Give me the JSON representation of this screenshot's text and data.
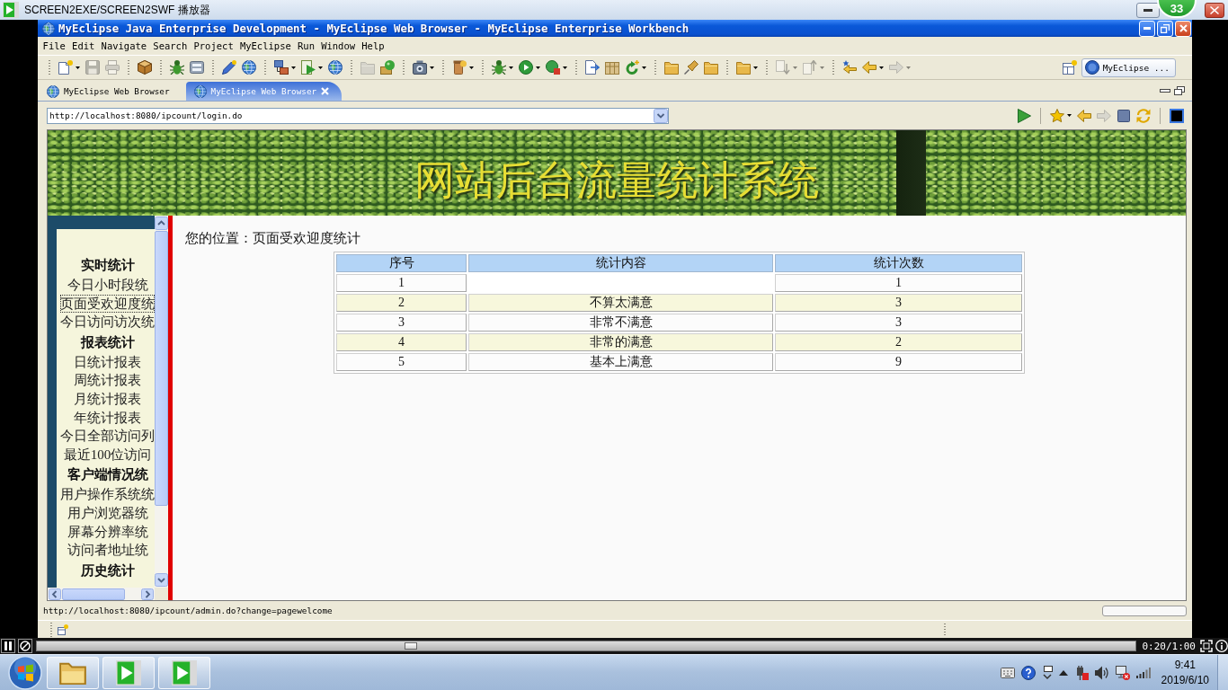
{
  "player_window": {
    "title": "SCREEN2EXE/SCREEN2SWF 播放器",
    "badge": "33"
  },
  "window": {
    "title": "MyEclipse Java Enterprise Development - MyEclipse Web Browser - MyEclipse Enterprise Workbench"
  },
  "menu": [
    "File",
    "Edit",
    "Navigate",
    "Search",
    "Project",
    "MyEclipse",
    "Run",
    "Window",
    "Help"
  ],
  "toolbar": [
    [
      {
        "kind": "new",
        "disabled": false,
        "dropdown": true
      },
      {
        "kind": "save",
        "disabled": true,
        "dropdown": false
      },
      {
        "kind": "print",
        "disabled": true,
        "dropdown": false
      }
    ],
    [
      {
        "kind": "cube",
        "disabled": false,
        "dropdown": false
      }
    ],
    [
      {
        "kind": "bug",
        "disabled": false,
        "dropdown": false
      },
      {
        "kind": "server",
        "disabled": false,
        "dropdown": false
      }
    ],
    [
      {
        "kind": "pencil",
        "disabled": false,
        "dropdown": false
      },
      {
        "kind": "globe",
        "disabled": false,
        "dropdown": false
      }
    ],
    [
      {
        "kind": "boxes",
        "disabled": false,
        "dropdown": true
      },
      {
        "kind": "pageplay",
        "disabled": false,
        "dropdown": true
      },
      {
        "kind": "globe",
        "disabled": false,
        "dropdown": false
      }
    ],
    [
      {
        "kind": "folder",
        "disabled": true,
        "dropdown": false
      },
      {
        "kind": "ball",
        "disabled": false,
        "dropdown": false
      }
    ],
    [
      {
        "kind": "camera",
        "disabled": false,
        "dropdown": true
      }
    ],
    [
      {
        "kind": "jar",
        "disabled": false,
        "dropdown": true
      }
    ],
    [
      {
        "kind": "bug",
        "disabled": false,
        "dropdown": true
      },
      {
        "kind": "play",
        "disabled": false,
        "dropdown": true
      },
      {
        "kind": "tool",
        "disabled": false,
        "dropdown": true
      }
    ],
    [
      {
        "kind": "openfile",
        "disabled": false,
        "dropdown": false
      },
      {
        "kind": "crate",
        "disabled": false,
        "dropdown": false
      },
      {
        "kind": "refresh",
        "disabled": false,
        "dropdown": true
      }
    ],
    [
      {
        "kind": "folder",
        "disabled": false,
        "dropdown": false
      },
      {
        "kind": "pin",
        "disabled": false,
        "dropdown": false
      },
      {
        "kind": "folder",
        "disabled": false,
        "dropdown": false
      }
    ],
    [
      {
        "kind": "folder",
        "disabled": false,
        "dropdown": true
      }
    ],
    [
      {
        "kind": "pagedown",
        "disabled": true,
        "dropdown": true
      },
      {
        "kind": "pageup",
        "disabled": true,
        "dropdown": true
      }
    ],
    [
      {
        "kind": "stararrow",
        "disabled": false,
        "dropdown": false
      },
      {
        "kind": "back",
        "disabled": false,
        "dropdown": true
      },
      {
        "kind": "forward",
        "disabled": true,
        "dropdown": true
      }
    ]
  ],
  "perspective": {
    "label": "MyEclipse ..."
  },
  "tabs": [
    {
      "label": "MyEclipse Web Browser",
      "selected": false
    },
    {
      "label": "MyEclipse Web Browser",
      "selected": true
    }
  ],
  "address": {
    "value": "http://localhost:8080/ipcount/login.do"
  },
  "browser_toolbar": [
    [
      {
        "kind": "go",
        "disabled": false,
        "dropdown": false
      }
    ],
    [
      {
        "kind": "star",
        "disabled": false,
        "dropdown": true
      },
      {
        "kind": "back",
        "disabled": false,
        "dropdown": false
      },
      {
        "kind": "forward",
        "disabled": true,
        "dropdown": false
      },
      {
        "kind": "stop",
        "disabled": false,
        "dropdown": false
      },
      {
        "kind": "reload",
        "disabled": false,
        "dropdown": false
      }
    ],
    [
      {
        "kind": "square",
        "disabled": false,
        "dropdown": false
      }
    ]
  ],
  "page": {
    "banner_title": "网站后台流量统计系统",
    "sidebar": [
      {
        "heading": "实时统计",
        "items": [
          {
            "label": "今日小时段统",
            "selected": false
          },
          {
            "label": "页面受欢迎度统",
            "selected": true
          },
          {
            "label": "今日访问访次统",
            "selected": false
          }
        ]
      },
      {
        "heading": "报表统计",
        "items": [
          {
            "label": "日统计报表",
            "selected": false
          },
          {
            "label": "周统计报表",
            "selected": false
          },
          {
            "label": "月统计报表",
            "selected": false
          },
          {
            "label": "年统计报表",
            "selected": false
          },
          {
            "label": "今日全部访问列",
            "selected": false
          },
          {
            "label": "最近100位访问",
            "selected": false
          }
        ]
      },
      {
        "heading": "客户端情况统",
        "items": [
          {
            "label": "用户操作系统统",
            "selected": false
          },
          {
            "label": "用户浏览器统",
            "selected": false
          },
          {
            "label": "屏幕分辨率统",
            "selected": false
          },
          {
            "label": "访问者地址统",
            "selected": false
          }
        ]
      },
      {
        "heading": "历史统计"
      }
    ],
    "breadcrumb": "您的位置：页面受欢迎度统计",
    "table": {
      "columns": [
        "序号",
        "统计内容",
        "统计次数"
      ],
      "rows": [
        {
          "index": "1",
          "count": "1"
        },
        {
          "index": "2",
          "content": "不算太满意",
          "count": "3"
        },
        {
          "index": "3",
          "content": "非常不满意",
          "count": "3"
        },
        {
          "index": "4",
          "content": "非常的满意",
          "count": "2"
        },
        {
          "index": "5",
          "content": "基本上满意",
          "count": "9"
        }
      ]
    }
  },
  "status_bar": {
    "text": "http://localhost:8080/ipcount/admin.do?change=pagewelcome"
  },
  "player_controls": {
    "level": 0.34,
    "time": "0:20/1:00"
  },
  "taskbar": {
    "apps": [
      {
        "kind": "folder"
      },
      {
        "kind": "player"
      },
      {
        "kind": "player"
      }
    ],
    "time": "9:41",
    "date": "2019/6/10"
  }
}
